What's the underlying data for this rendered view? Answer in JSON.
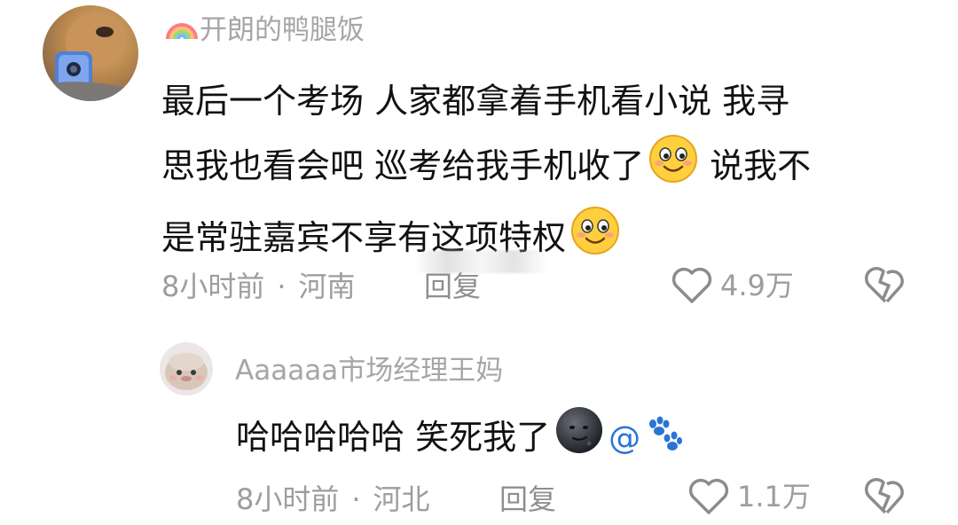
{
  "comments": [
    {
      "username": "开朗的鸭腿饭",
      "username_badge_icon": "rainbow-icon",
      "content_lines": [
        "最后一个考场 人家都拿着手机看小说 我寻",
        "思我也看会吧 巡考给我手机收了",
        " 说我不",
        "是常驻嘉宾不享有这项特权"
      ],
      "emoji": "smiling-face-icon",
      "time": "8小时前",
      "separator": "·",
      "location": "河南",
      "reply_label": "回复",
      "like_count": "4.9万"
    },
    {
      "username": "Aaaaaa市场经理王妈",
      "content": "哈哈哈哈哈 笑死我了",
      "mention_symbol": "@",
      "emoji": "dark-moon-face-icon",
      "paw_icon": "paw-prints-icon",
      "time": "8小时前",
      "separator": "·",
      "location": "河北",
      "reply_label": "回复",
      "like_count": "1.1万"
    }
  ],
  "colors": {
    "text": "#111111",
    "meta": "#9d9d9d",
    "link": "#2b74d6"
  }
}
